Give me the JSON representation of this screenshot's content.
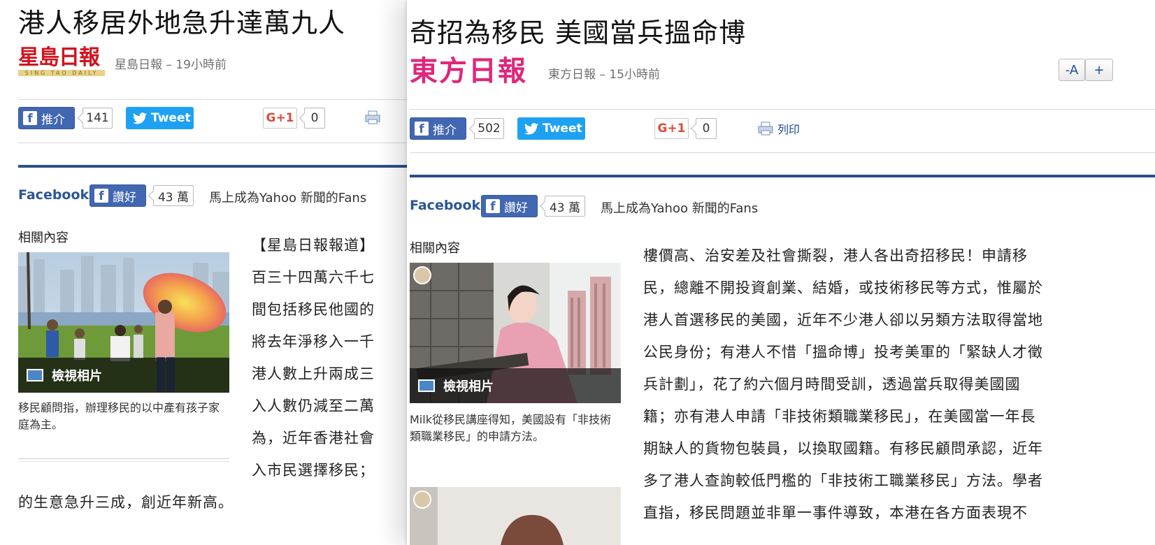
{
  "left": {
    "title": "港人移居外地急升達萬九人",
    "logo_text": "星島日報",
    "logo_sub": "SING TAO DAILY",
    "source": "星島日報 – 19小時前",
    "share": {
      "fb_label": "推介",
      "fb_count": "141",
      "tweet": "Tweet",
      "gplus": "G+1",
      "gplus_count": "0"
    },
    "facebook": {
      "label": "Facebook",
      "like": "讚好",
      "count": "43 萬",
      "fans": "馬上成為Yahoo 新聞的Fans"
    },
    "related": "相關內容",
    "photo_button": "檢視相片",
    "caption": "移民顧問指，辦理移民的以中產有孩子家庭為主。",
    "body": [
      "【星島日報報道】",
      "百三十四萬六千七",
      "間包括移民他國的",
      "將去年淨移入一千",
      "港人數上升兩成三",
      "入人數仍減至二萬",
      "為，近年香港社會",
      "入市民選擇移民；"
    ],
    "body_full": "的生意急升三成，創近年新高。"
  },
  "right": {
    "title": "奇招為移民 美國當兵搵命博",
    "logo_text": "東方日報",
    "source": "東方日報 – 15小時前",
    "font_small": "-A",
    "font_large": "+",
    "share": {
      "fb_label": "推介",
      "fb_count": "502",
      "tweet": "Tweet",
      "gplus": "G+1",
      "gplus_count": "0",
      "print": "列印"
    },
    "facebook": {
      "label": "Facebook",
      "like": "讚好",
      "count": "43 萬",
      "fans": "馬上成為Yahoo 新聞的Fans"
    },
    "related": "相關內容",
    "photo_button": "檢視相片",
    "caption": "Milk從移民講座得知，美國設有「非技術類職業移民」的申請方法。",
    "body": [
      "樓價高、治安差及社會撕裂，港人各出奇招移民！申請移",
      "民，總離不開投資創業、結婚，或技術移民等方式，惟屬於",
      "港人首選移民的美國，近年不少港人卻以另類方法取得當地",
      "公民身份；有港人不惜「搵命博」投考美軍的「緊缺人才徵",
      "兵計劃」，花了約六個月時間受訓，透過當兵取得美國國",
      "籍；亦有港人申請「非技術類職業移民」，在美國當一年長",
      "期缺人的貨物包裝員，以換取國籍。有移民顧問承認，近年",
      "多了港人查詢較低門檻的「非技術工職業移民」方法。學者",
      "直指，移民問題並非單一事件導致，本港在各方面表現不"
    ]
  },
  "colors": {
    "fb_blue": "#4267b2",
    "twitter_blue": "#1da1f2",
    "gplus_red": "#dd4b39",
    "rule_blue": "#2d4f8a",
    "oriental_pink": "#e0267a"
  }
}
